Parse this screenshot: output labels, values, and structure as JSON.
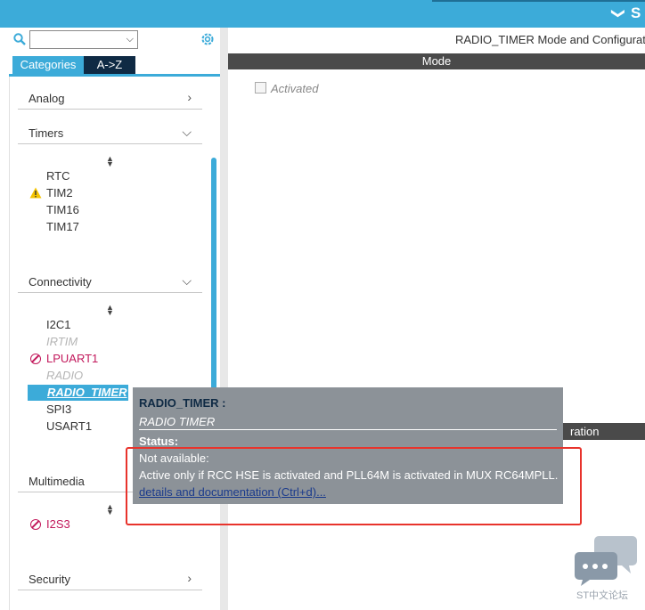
{
  "topbar": {
    "chevron": "❯",
    "title_fragment": "S"
  },
  "left": {
    "search": {
      "value": ""
    },
    "tabs": [
      {
        "label": "Categories"
      },
      {
        "label": "A->Z"
      }
    ],
    "categories": {
      "analog": "Analog",
      "timers": "Timers",
      "connectivity": "Connectivity",
      "multimedia": "Multimedia",
      "security": "Security"
    },
    "timers": [
      "RTC",
      "TIM2",
      "TIM16",
      "TIM17"
    ],
    "connectivity": [
      "I2C1",
      "IRTIM",
      "LPUART1",
      "RADIO",
      "RADIO_TIMER",
      "SPI3",
      "USART1"
    ],
    "multimedia": [
      "I2S3"
    ]
  },
  "right": {
    "mode_title": "RADIO_TIMER Mode and Configurati",
    "mode_bar": "Mode",
    "activated_label": "Activated",
    "config_bar_fragment": "ration"
  },
  "tooltip": {
    "title": "RADIO_TIMER :",
    "subtitle": "RADIO TIMER",
    "status_label": "Status:",
    "status_value": "Not available:",
    "detail": "Active only if RCC HSE is activated and PLL64M is activated in MUX RC64MPLL.",
    "link": "details and documentation (Ctrl+d)..."
  },
  "watermark": {
    "text": "ST中文论坛"
  },
  "colors": {
    "accent": "#3cabd9",
    "dark_tab": "#0f2a44",
    "error": "#c2185b",
    "highlight_box": "#e8332c"
  }
}
